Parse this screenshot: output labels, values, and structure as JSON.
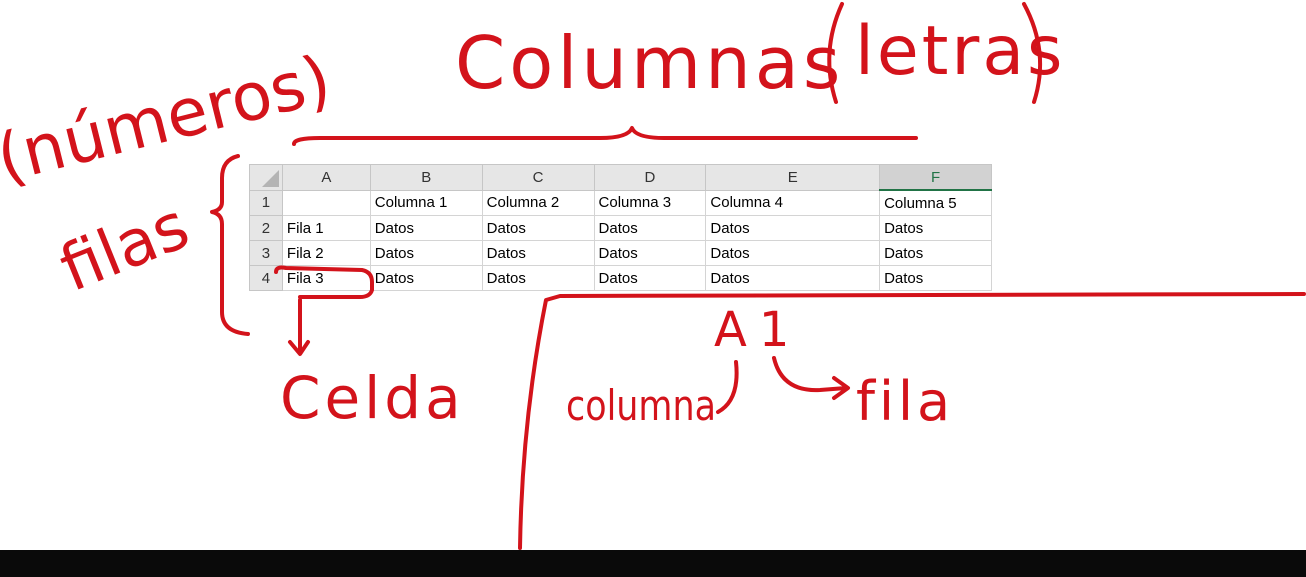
{
  "spreadsheet": {
    "corner": "",
    "columns": [
      "A",
      "B",
      "C",
      "D",
      "E",
      "F"
    ],
    "selected_column": "F",
    "rows": [
      {
        "num": "1",
        "cells": [
          "",
          "Columna 1",
          "Columna 2",
          "Columna 3",
          "Columna 4",
          "Columna 5"
        ]
      },
      {
        "num": "2",
        "cells": [
          "Fila 1",
          "Datos",
          "Datos",
          "Datos",
          "Datos",
          "Datos"
        ]
      },
      {
        "num": "3",
        "cells": [
          "Fila 2",
          "Datos",
          "Datos",
          "Datos",
          "Datos",
          "Datos"
        ]
      },
      {
        "num": "4",
        "cells": [
          "Fila 3",
          "Datos",
          "Datos",
          "Datos",
          "Datos",
          "Datos"
        ]
      }
    ]
  },
  "annotations": {
    "numeros": "(números)",
    "filas": "filas",
    "columnas": "Columnas",
    "letras": "letras",
    "celda": "Celda",
    "cell_ref": "A1",
    "columna": "columna",
    "fila": "fila",
    "ink_color": "#d3131b"
  }
}
